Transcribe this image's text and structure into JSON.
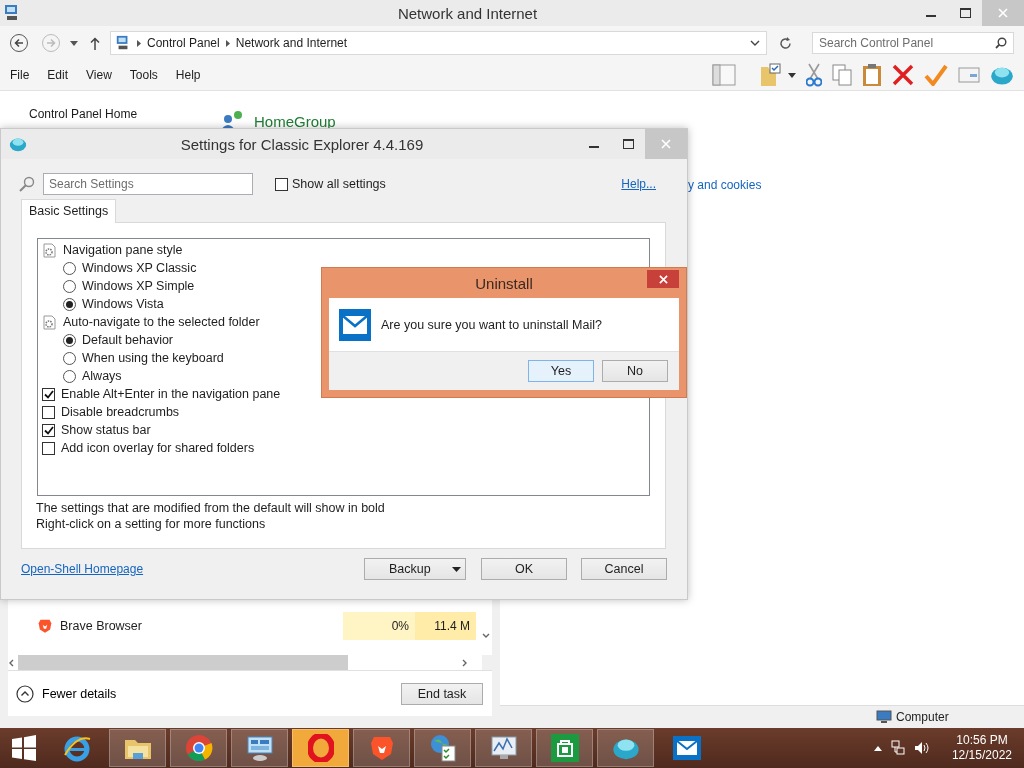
{
  "explorer": {
    "title": "Network and Internet",
    "breadcrumb": [
      "Control Panel",
      "Network and Internet"
    ],
    "search": {
      "placeholder": "Search Control Panel"
    },
    "menu": [
      "File",
      "Edit",
      "View",
      "Tools",
      "Help"
    ],
    "sidebar_link": "Control Panel Home",
    "category": "HomeGroup",
    "link_fragment": "y and cookies",
    "status": "Computer"
  },
  "task_manager": {
    "rows": [
      {
        "name": "Brave Browser",
        "cpu": "0%",
        "memory": "11.4 M"
      }
    ],
    "fewer_details": "Fewer details",
    "end_task": "End task"
  },
  "settings": {
    "title": "Settings for Classic Explorer 4.4.169",
    "search": {
      "placeholder": "Search Settings"
    },
    "show_all": {
      "label": "Show all settings",
      "checked": false
    },
    "help": "Help...",
    "tabs": [
      {
        "label": "Basic Settings",
        "selected": true
      }
    ],
    "items": [
      {
        "kind": "group",
        "label": "Navigation pane style",
        "children": [
          {
            "kind": "radio",
            "label": "Windows XP Classic",
            "selected": false
          },
          {
            "kind": "radio",
            "label": "Windows XP Simple",
            "selected": false
          },
          {
            "kind": "radio",
            "label": "Windows Vista",
            "selected": true
          }
        ]
      },
      {
        "kind": "group",
        "label": "Auto-navigate to the selected folder",
        "children": [
          {
            "kind": "radio",
            "label": "Default behavior",
            "selected": true
          },
          {
            "kind": "radio",
            "label": "When using the keyboard",
            "selected": false
          },
          {
            "kind": "radio",
            "label": "Always",
            "selected": false
          }
        ]
      },
      {
        "kind": "checkbox",
        "label": "Enable Alt+Enter in the navigation pane",
        "checked": true
      },
      {
        "kind": "checkbox",
        "label": "Disable breadcrumbs",
        "checked": false
      },
      {
        "kind": "checkbox",
        "label": "Show status bar",
        "checked": true
      },
      {
        "kind": "checkbox",
        "label": "Add icon overlay for shared folders",
        "checked": false
      }
    ],
    "notes": [
      "The settings that are modified from the default will show in bold",
      "Right-click on a setting for more functions"
    ],
    "homepage": "Open-Shell Homepage",
    "buttons": [
      "Backup",
      "OK",
      "Cancel"
    ]
  },
  "dialog": {
    "title": "Uninstall",
    "message": "Are you sure you want to uninstall Mail?",
    "buttons": [
      {
        "label": "Yes",
        "selected": true
      },
      {
        "label": "No",
        "selected": false
      }
    ]
  },
  "taskbar": {
    "apps": [
      {
        "kind": "ie",
        "running": false
      },
      {
        "kind": "files",
        "running": true
      },
      {
        "kind": "chrome",
        "running": true
      },
      {
        "kind": "control",
        "running": true
      },
      {
        "kind": "opera",
        "running": true
      },
      {
        "kind": "brave",
        "running": true
      },
      {
        "kind": "network",
        "running": true
      },
      {
        "kind": "monitor",
        "running": true
      },
      {
        "kind": "store",
        "running": true
      },
      {
        "kind": "shell",
        "running": true
      },
      {
        "kind": "mail",
        "running": false
      }
    ],
    "clock": {
      "time": "10:56 PM",
      "date": "12/15/2022"
    }
  }
}
